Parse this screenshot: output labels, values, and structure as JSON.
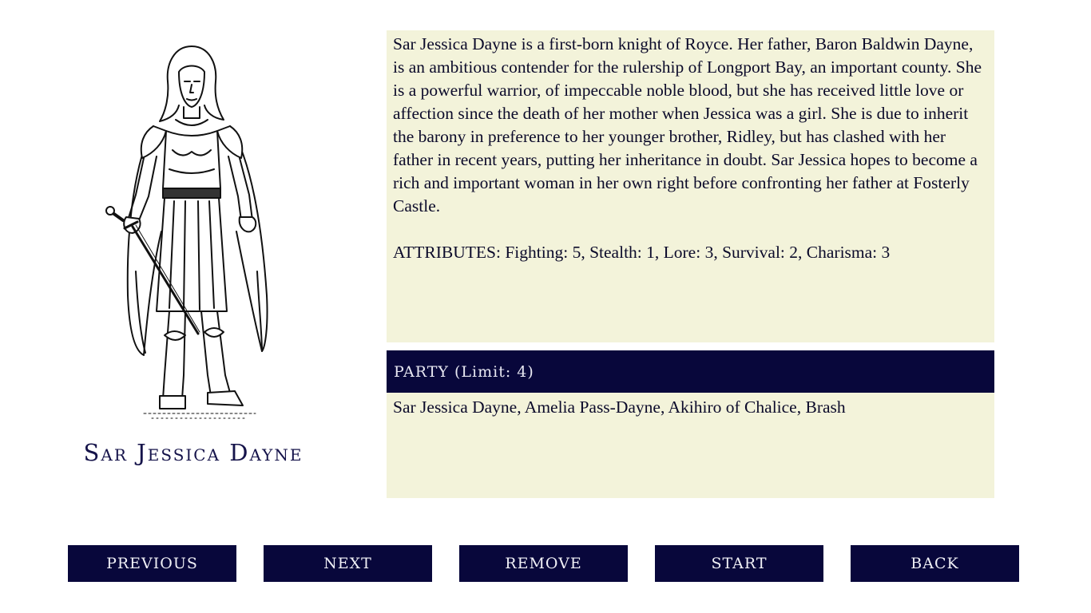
{
  "character": {
    "name": "Sar Jessica Dayne",
    "portrait_icon": "knight-portrait",
    "bio": "Sar Jessica Dayne is a first-born knight of Royce. Her father, Baron Baldwin Dayne, is an ambitious contender for the rulership of Longport Bay, an important county. She is a powerful warrior, of impeccable noble blood, but she has received little love or affection since the death of her mother when Jessica was a girl. She is due to inherit the barony in preference to her younger brother, Ridley, but has clashed with her father in recent years, putting her inheritance in doubt. Sar Jessica hopes to become a rich and important woman in her own right before confronting her father at Fosterly Castle.",
    "attributes": "ATTRIBUTES: Fighting: 5, Stealth: 1, Lore: 3, Survival: 2, Charisma: 3"
  },
  "party": {
    "header": "PARTY (Limit: 4)",
    "members": "Sar Jessica Dayne, Amelia Pass-Dayne, Akihiro of Chalice, Brash"
  },
  "buttons": {
    "previous": "Previous",
    "next": "Next",
    "remove": "Remove",
    "start": "Start",
    "back": "Back"
  },
  "colors": {
    "panel_bg": "#f3f3da",
    "header_bg": "#08073b",
    "button_bg": "#08073b",
    "text": "#0b0a2a"
  }
}
